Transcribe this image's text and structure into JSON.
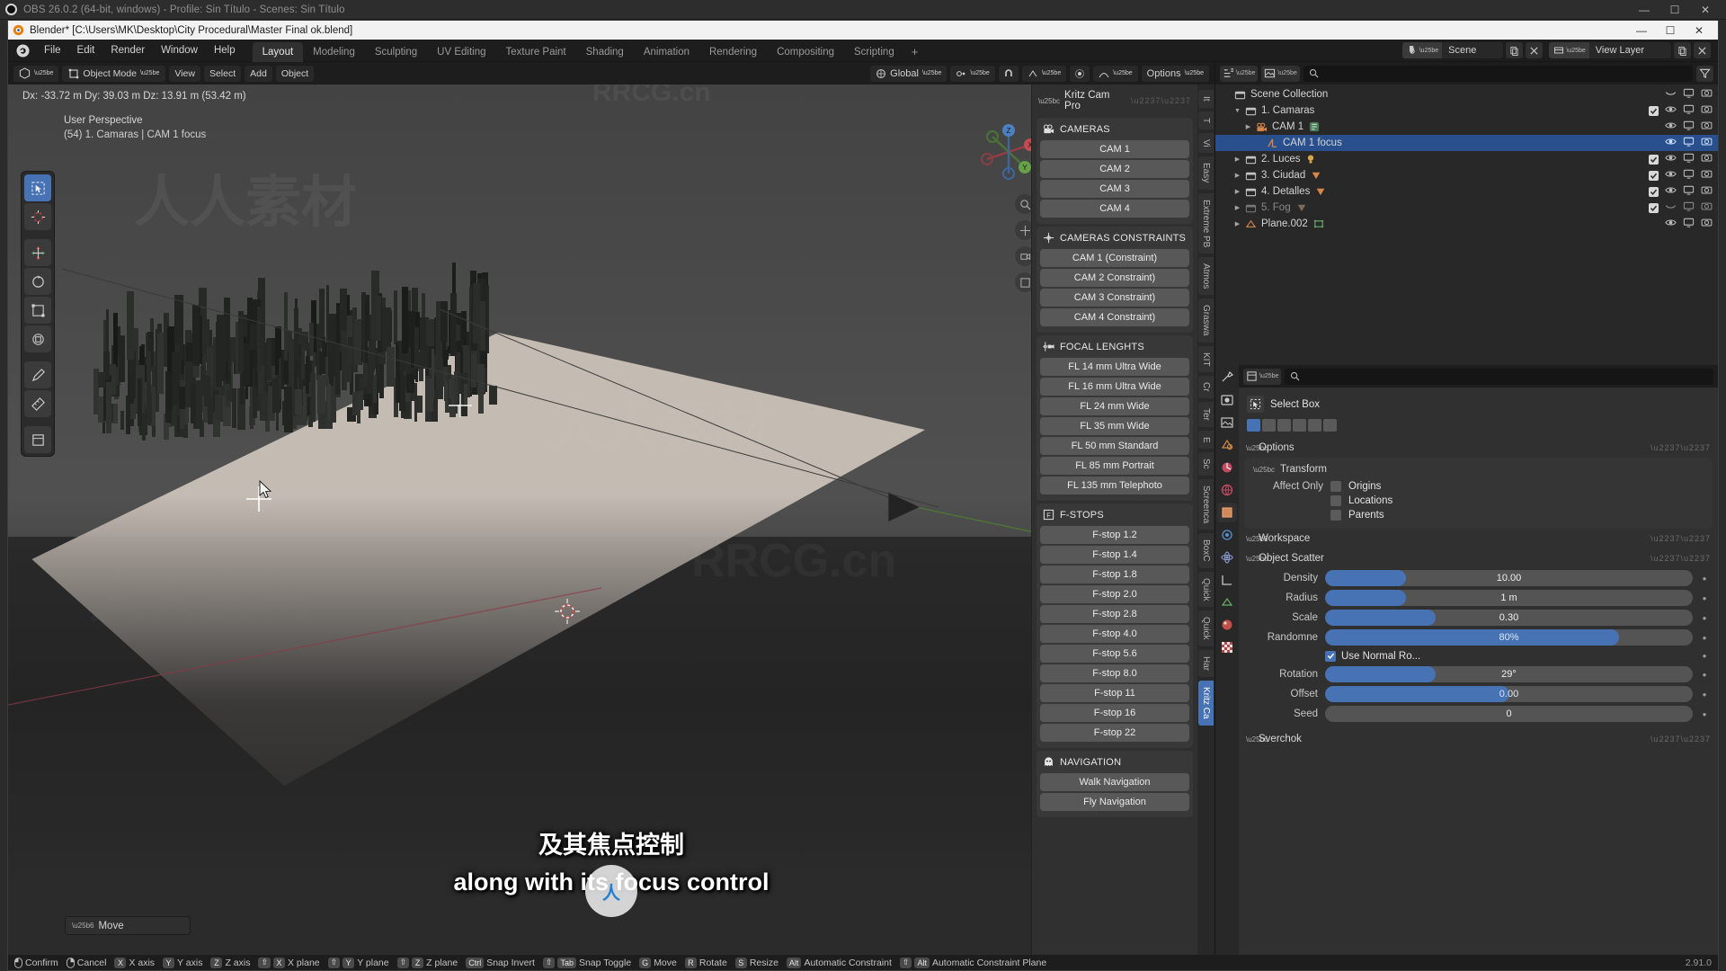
{
  "obs": {
    "title": "OBS 26.0.2 (64-bit, windows) - Profile: Sin Título - Scenes: Sin Título",
    "minimize": "—",
    "maximize": "☐",
    "close": "✕"
  },
  "blender_window": {
    "title": "Blender* [C:\\Users\\MK\\Desktop\\City Procedural\\Master Final ok.blend]",
    "minimize": "—",
    "maximize": "☐",
    "close": "✕"
  },
  "topbar": {
    "menus": [
      "File",
      "Edit",
      "Render",
      "Window",
      "Help"
    ],
    "workspaces": [
      {
        "label": "Layout",
        "active": true
      },
      {
        "label": "Modeling",
        "active": false
      },
      {
        "label": "Sculpting",
        "active": false
      },
      {
        "label": "UV Editing",
        "active": false
      },
      {
        "label": "Texture Paint",
        "active": false
      },
      {
        "label": "Shading",
        "active": false
      },
      {
        "label": "Animation",
        "active": false
      },
      {
        "label": "Rendering",
        "active": false
      },
      {
        "label": "Compositing",
        "active": false
      },
      {
        "label": "Scripting",
        "active": false
      }
    ],
    "add_workspace": "+",
    "scene_name": "Scene",
    "view_layer_name": "View Layer"
  },
  "viewport": {
    "transform_orientation": "Global",
    "options_label": "Options",
    "delta_readout": "Dx: -33.72 m  Dy: 39.03 m  Dz: 13.91 m (53.42 m)",
    "perspective_label": "User Perspective",
    "active_object_label": "(54) 1. Camaras | CAM 1 focus",
    "operator_panel_label": "Move"
  },
  "subtitles": {
    "line_cn": "及其焦点控制",
    "line_en": "along with its focus control"
  },
  "npanel": {
    "title": "Kritz Cam Pro",
    "sections": [
      {
        "icon": "camera-icon",
        "title": "CAMERAS",
        "buttons": [
          "CAM 1",
          "CAM 2",
          "CAM 3",
          "CAM 4"
        ]
      },
      {
        "icon": "constraint-icon",
        "title": "CAMERAS CONSTRAINTS",
        "buttons": [
          "CAM 1 (Constraint)",
          "CAM 2 Constraint)",
          "CAM 3 Constraint)",
          "CAM 4 Constraint)"
        ]
      },
      {
        "icon": "focal-icon",
        "title": "FOCAL LENGHTS",
        "buttons": [
          "FL 14 mm Ultra Wide",
          "FL 16 mm Ultra Wide",
          "FL 24 mm Wide",
          "FL 35 mm Wide",
          "FL 50 mm Standard",
          "FL 85 mm Portrait",
          "FL 135 mm Telephoto"
        ]
      },
      {
        "icon": "fstop-icon",
        "title": "F-STOPS",
        "buttons": [
          "F-stop 1.2",
          "F-stop 1.4",
          "F-stop 1.8",
          "F-stop 2.0",
          "F-stop 2.8",
          "F-stop 4.0",
          "F-stop 5.6",
          "F-stop 8.0",
          "F-stop 11",
          "F-stop 16",
          "F-stop 22"
        ]
      },
      {
        "icon": "navigation-icon",
        "title": "NAVIGATION",
        "buttons": [
          "Walk Navigation",
          "Fly Navigation"
        ]
      }
    ],
    "tabs": [
      {
        "label": "It",
        "active": false
      },
      {
        "label": "T",
        "active": false
      },
      {
        "label": "Vi",
        "active": false
      },
      {
        "label": "Easy",
        "active": false
      },
      {
        "label": "Extreme PB",
        "active": false
      },
      {
        "label": "Atmos",
        "active": false
      },
      {
        "label": "Graswa",
        "active": false
      },
      {
        "label": "KIT",
        "active": false
      },
      {
        "label": "Cr",
        "active": false
      },
      {
        "label": "Ter",
        "active": false
      },
      {
        "label": "E",
        "active": false
      },
      {
        "label": "Sc",
        "active": false
      },
      {
        "label": "Screenca",
        "active": false
      },
      {
        "label": "BoxC",
        "active": false
      },
      {
        "label": "Quick",
        "active": false
      },
      {
        "label": "Quick",
        "active": false
      },
      {
        "label": "Har",
        "active": false
      },
      {
        "label": "Kritz Ca",
        "active": true
      }
    ]
  },
  "outliner": {
    "search_placeholder": "",
    "rows": [
      {
        "label": "Scene Collection",
        "indent": 0,
        "disclosure": "",
        "icon": "collection-icon",
        "selected": false,
        "dim": false,
        "show_checkbox": false,
        "show_eye": false,
        "show_screen": false,
        "show_camera": false
      },
      {
        "label": "1. Camaras",
        "indent": 1,
        "disclosure": "▼",
        "icon": "collection-icon",
        "selected": false,
        "dim": false,
        "show_checkbox": true,
        "show_eye": true,
        "show_screen": true,
        "show_camera": true
      },
      {
        "label": "CAM 1",
        "indent": 2,
        "disclosure": "▶",
        "icon": "camera-object-icon",
        "badge": "constraint-badge",
        "selected": false,
        "dim": false,
        "show_checkbox": false,
        "show_eye": true,
        "show_screen": true,
        "show_camera": true
      },
      {
        "label": "CAM 1 focus",
        "indent": 3,
        "disclosure": "",
        "icon": "empty-icon",
        "selected": true,
        "dim": false,
        "show_checkbox": false,
        "show_eye": true,
        "show_screen": true,
        "show_camera": true
      },
      {
        "label": "2. Luces",
        "indent": 1,
        "disclosure": "▶",
        "icon": "collection-icon",
        "badge": "light-badge",
        "selected": false,
        "dim": false,
        "show_checkbox": true,
        "show_eye": true,
        "show_screen": true,
        "show_camera": true
      },
      {
        "label": "3. Ciudad",
        "indent": 1,
        "disclosure": "▶",
        "icon": "collection-icon",
        "badge": "mesh-badge",
        "selected": false,
        "dim": false,
        "show_checkbox": true,
        "show_eye": true,
        "show_screen": true,
        "show_camera": true
      },
      {
        "label": "4. Detalles",
        "indent": 1,
        "disclosure": "▶",
        "icon": "collection-icon",
        "badge": "mesh-badge",
        "selected": false,
        "dim": false,
        "show_checkbox": true,
        "show_eye": true,
        "show_screen": true,
        "show_camera": true
      },
      {
        "label": "5. Fog",
        "indent": 1,
        "disclosure": "▶",
        "icon": "collection-icon",
        "badge": "mesh-badge-dim",
        "selected": false,
        "dim": true,
        "show_checkbox": true,
        "show_eye": false,
        "show_screen": true,
        "show_camera": true
      },
      {
        "label": "Plane.002",
        "indent": 1,
        "disclosure": "▶",
        "icon": "mesh-object-icon",
        "badge": "mesh-data-badge",
        "selected": false,
        "dim": false,
        "show_checkbox": false,
        "show_eye": true,
        "show_screen": true,
        "show_camera": true
      }
    ]
  },
  "properties": {
    "active_tool": {
      "name": "Select Box",
      "icon": "select-box-icon"
    },
    "panels": [
      {
        "title": "Options",
        "expanded": true
      },
      {
        "title": "Transform",
        "expanded": true
      },
      {
        "title": "Workspace",
        "expanded": false
      },
      {
        "title": "Object Scatter",
        "expanded": true
      },
      {
        "title": "Sverchok",
        "expanded": false
      }
    ],
    "affect_only": {
      "label": "Affect Only",
      "options": [
        {
          "label": "Origins",
          "checked": false
        },
        {
          "label": "Locations",
          "checked": false
        },
        {
          "label": "Parents",
          "checked": false
        }
      ]
    },
    "object_scatter": {
      "fields": [
        {
          "label": "Density",
          "value": "10.00",
          "fill_pct": 22,
          "style": "normal"
        },
        {
          "label": "Radius",
          "value": "1 m",
          "fill_pct": 22,
          "style": "normal"
        },
        {
          "label": "Scale",
          "value": "0.30",
          "fill_pct": 30,
          "style": "normal"
        },
        {
          "label": "Randomne",
          "value": "80%",
          "fill_pct": 80,
          "style": "blue"
        }
      ],
      "use_normal_rotation": {
        "label": "Use Normal Ro...",
        "checked": true
      },
      "fields2": [
        {
          "label": "Rotation",
          "value": "29°",
          "fill_pct": 30,
          "style": "normal"
        },
        {
          "label": "Offset",
          "value": "0.00",
          "fill_pct": 50,
          "style": "blue"
        },
        {
          "label": "Seed",
          "value": "0",
          "fill_pct": 0,
          "style": "normal"
        }
      ]
    }
  },
  "statusbar": {
    "items": [
      {
        "keys": [],
        "label": "Confirm",
        "icon": "mouse-left"
      },
      {
        "keys": [],
        "label": "Cancel",
        "icon": "mouse-right"
      },
      {
        "keys": [
          "X"
        ],
        "label": "X axis"
      },
      {
        "keys": [
          "Y"
        ],
        "label": "Y axis"
      },
      {
        "keys": [
          "Z"
        ],
        "label": "Z axis"
      },
      {
        "keys": [
          "⇧",
          "X"
        ],
        "label": "X plane"
      },
      {
        "keys": [
          "⇧",
          "Y"
        ],
        "label": "Y plane"
      },
      {
        "keys": [
          "⇧",
          "Z"
        ],
        "label": "Z plane"
      },
      {
        "keys": [
          "Ctrl"
        ],
        "label": "Snap Invert"
      },
      {
        "keys": [
          "⇧",
          "Tab"
        ],
        "label": "Snap Toggle"
      },
      {
        "keys": [
          "G"
        ],
        "label": "Move"
      },
      {
        "keys": [
          "R"
        ],
        "label": "Rotate"
      },
      {
        "keys": [
          "S"
        ],
        "label": "Resize"
      },
      {
        "keys": [
          "Alt"
        ],
        "label": "Automatic Constraint"
      },
      {
        "keys": [
          "⇧",
          "Alt"
        ],
        "label": "Automatic Constraint Plane"
      }
    ],
    "version": "2.91.0"
  },
  "watermarks": {
    "site": "RRCG.cn",
    "cn_large": "人人素材",
    "badge": "人"
  },
  "colors": {
    "accent_blue": "#4772b3",
    "selection_blue": "#29508d",
    "panel_bg": "#303030",
    "header_bg": "#1d1d1d",
    "button_gray": "#585858"
  }
}
